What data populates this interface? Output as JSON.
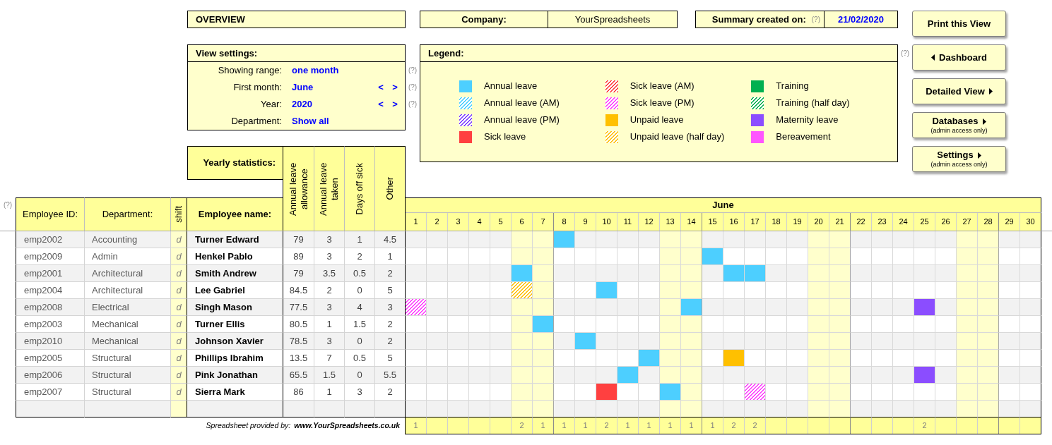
{
  "overview": {
    "title": "OVERVIEW"
  },
  "company": {
    "label": "Company:",
    "value": "YourSpreadsheets"
  },
  "summary": {
    "label": "Summary created on:",
    "help": "(?)",
    "value": "21/02/2020"
  },
  "buttons": [
    {
      "label": "Print this View",
      "kind": "plain"
    },
    {
      "label": "Dashboard",
      "kind": "back"
    },
    {
      "label": "Detailed View",
      "kind": "forward"
    },
    {
      "label": "Databases",
      "kind": "forward",
      "note": "(admin access only)"
    },
    {
      "label": "Settings",
      "kind": "forward",
      "note": "(admin access only)"
    }
  ],
  "view_settings": {
    "title": "View settings:",
    "rows": [
      {
        "label": "Showing range:",
        "value": "one month",
        "help": "(?)"
      },
      {
        "label": "First month:",
        "value": "June",
        "previous": "<",
        "next": ">",
        "help": "(?)"
      },
      {
        "label": "Year:",
        "value": "2020",
        "previous": "<",
        "next": ">",
        "help": "(?)"
      },
      {
        "label": "Department:",
        "value": "Show all"
      }
    ]
  },
  "legend": {
    "title": "Legend:",
    "help": "(?)",
    "columns": [
      {
        "items": [
          {
            "label": "Annual leave",
            "color": "#4dcfff",
            "kind": "solid"
          },
          {
            "label": "Annual leave (AM)",
            "color": "#4dcfff",
            "kind": "hatched"
          },
          {
            "label": "Annual leave (PM)",
            "color": "#7f3fff",
            "kind": "hatched"
          },
          {
            "label": "Sick leave",
            "color": "#ff4040",
            "kind": "solid"
          }
        ]
      },
      {
        "items": [
          {
            "label": "Sick leave (AM)",
            "color": "#ff4040",
            "kind": "hatched"
          },
          {
            "label": "Sick leave (PM)",
            "color": "#ff40ff",
            "kind": "hatched"
          },
          {
            "label": "Unpaid leave",
            "color": "#ffc000",
            "kind": "solid"
          },
          {
            "label": "Unpaid leave (half day)",
            "color": "#ffc000",
            "kind": "hatched"
          }
        ]
      },
      {
        "items": [
          {
            "label": "Training",
            "color": "#00b050",
            "kind": "solid"
          },
          {
            "label": "Training (half day)",
            "color": "#00b050",
            "kind": "hatched"
          },
          {
            "label": "Maternity leave",
            "color": "#8b4dff",
            "kind": "solid"
          },
          {
            "label": "Bereavement",
            "color": "#ff55ff",
            "kind": "solid"
          }
        ]
      }
    ]
  },
  "table": {
    "help": "(?)",
    "statistics_title": "Yearly statistics:",
    "columns": [
      {
        "label": "Employee ID:"
      },
      {
        "label": "Department:"
      },
      {
        "label": "shift"
      },
      {
        "label": "Employee name:"
      }
    ],
    "stat_columns": [
      {
        "label": "Annual leave allowance"
      },
      {
        "label": "Annual leave taken"
      },
      {
        "label": "Days off sick"
      },
      {
        "label": "Other"
      }
    ],
    "month": "June",
    "days": [
      {
        "label": "1",
        "weekend": false,
        "total": "1"
      },
      {
        "label": "2",
        "weekend": false
      },
      {
        "label": "3",
        "weekend": false
      },
      {
        "label": "4",
        "weekend": false
      },
      {
        "label": "5",
        "weekend": false
      },
      {
        "label": "6",
        "weekend": true,
        "total": "2"
      },
      {
        "label": "7",
        "weekend": true,
        "total": "1"
      },
      {
        "label": "8",
        "weekend": false,
        "total": "1"
      },
      {
        "label": "9",
        "weekend": false,
        "total": "1"
      },
      {
        "label": "10",
        "weekend": false,
        "total": "2"
      },
      {
        "label": "11",
        "weekend": false,
        "total": "1"
      },
      {
        "label": "12",
        "weekend": false,
        "total": "1"
      },
      {
        "label": "13",
        "weekend": true,
        "total": "1"
      },
      {
        "label": "14",
        "weekend": true,
        "total": "1"
      },
      {
        "label": "15",
        "weekend": false,
        "total": "1"
      },
      {
        "label": "16",
        "weekend": false,
        "total": "2"
      },
      {
        "label": "17",
        "weekend": false,
        "total": "2"
      },
      {
        "label": "18",
        "weekend": false
      },
      {
        "label": "19",
        "weekend": false
      },
      {
        "label": "20",
        "weekend": true
      },
      {
        "label": "21",
        "weekend": true
      },
      {
        "label": "22",
        "weekend": false
      },
      {
        "label": "23",
        "weekend": false
      },
      {
        "label": "24",
        "weekend": false
      },
      {
        "label": "25",
        "weekend": false,
        "total": "2"
      },
      {
        "label": "26",
        "weekend": false
      },
      {
        "label": "27",
        "weekend": true
      },
      {
        "label": "28",
        "weekend": true
      },
      {
        "label": "29",
        "weekend": false
      },
      {
        "label": "30",
        "weekend": false
      }
    ],
    "rows": [
      {
        "id": "emp2002",
        "department": "Accounting",
        "shift": "d",
        "name": "Turner Edward",
        "stats": [
          "79",
          "3",
          "1",
          "4.5"
        ],
        "cells": [
          {
            "kind": "blank"
          },
          {
            "kind": "blank"
          },
          {
            "kind": "blank"
          },
          {
            "kind": "blank"
          },
          {
            "kind": "blank"
          },
          {
            "kind": "blank"
          },
          {
            "kind": "blank"
          },
          {
            "kind": "solid",
            "color": "#4dcfff"
          },
          {
            "kind": "blank"
          },
          {
            "kind": "blank"
          },
          {
            "kind": "blank"
          },
          {
            "kind": "blank"
          },
          {
            "kind": "blank"
          },
          {
            "kind": "blank"
          },
          {
            "kind": "blank"
          },
          {
            "kind": "blank"
          },
          {
            "kind": "blank"
          },
          {
            "kind": "blank"
          },
          {
            "kind": "blank"
          },
          {
            "kind": "blank"
          },
          {
            "kind": "blank"
          },
          {
            "kind": "blank"
          },
          {
            "kind": "blank"
          },
          {
            "kind": "blank"
          },
          {
            "kind": "blank"
          },
          {
            "kind": "blank"
          },
          {
            "kind": "blank"
          },
          {
            "kind": "blank"
          },
          {
            "kind": "blank"
          },
          {
            "kind": "blank"
          }
        ]
      },
      {
        "id": "emp2009",
        "department": "Admin",
        "shift": "d",
        "name": "Henkel Pablo",
        "stats": [
          "89",
          "3",
          "2",
          "1"
        ],
        "cells": [
          {
            "kind": "blank"
          },
          {
            "kind": "blank"
          },
          {
            "kind": "blank"
          },
          {
            "kind": "blank"
          },
          {
            "kind": "blank"
          },
          {
            "kind": "blank"
          },
          {
            "kind": "blank"
          },
          {
            "kind": "blank"
          },
          {
            "kind": "blank"
          },
          {
            "kind": "blank"
          },
          {
            "kind": "blank"
          },
          {
            "kind": "blank"
          },
          {
            "kind": "blank"
          },
          {
            "kind": "blank"
          },
          {
            "kind": "solid",
            "color": "#4dcfff"
          },
          {
            "kind": "blank"
          },
          {
            "kind": "blank"
          },
          {
            "kind": "blank"
          },
          {
            "kind": "blank"
          },
          {
            "kind": "blank"
          },
          {
            "kind": "blank"
          },
          {
            "kind": "blank"
          },
          {
            "kind": "blank"
          },
          {
            "kind": "blank"
          },
          {
            "kind": "blank"
          },
          {
            "kind": "blank"
          },
          {
            "kind": "blank"
          },
          {
            "kind": "blank"
          },
          {
            "kind": "blank"
          },
          {
            "kind": "blank"
          }
        ]
      },
      {
        "id": "emp2001",
        "department": "Architectural",
        "shift": "d",
        "name": "Smith Andrew",
        "stats": [
          "79",
          "3.5",
          "0.5",
          "2"
        ],
        "cells": [
          {
            "kind": "blank"
          },
          {
            "kind": "blank"
          },
          {
            "kind": "blank"
          },
          {
            "kind": "blank"
          },
          {
            "kind": "blank"
          },
          {
            "kind": "solid",
            "color": "#4dcfff"
          },
          {
            "kind": "blank"
          },
          {
            "kind": "blank"
          },
          {
            "kind": "blank"
          },
          {
            "kind": "blank"
          },
          {
            "kind": "blank"
          },
          {
            "kind": "blank"
          },
          {
            "kind": "blank"
          },
          {
            "kind": "blank"
          },
          {
            "kind": "blank"
          },
          {
            "kind": "solid",
            "color": "#4dcfff"
          },
          {
            "kind": "solid",
            "color": "#4dcfff"
          },
          {
            "kind": "blank"
          },
          {
            "kind": "blank"
          },
          {
            "kind": "blank"
          },
          {
            "kind": "blank"
          },
          {
            "kind": "blank"
          },
          {
            "kind": "blank"
          },
          {
            "kind": "blank"
          },
          {
            "kind": "blank"
          },
          {
            "kind": "blank"
          },
          {
            "kind": "blank"
          },
          {
            "kind": "blank"
          },
          {
            "kind": "blank"
          },
          {
            "kind": "blank"
          }
        ]
      },
      {
        "id": "emp2004",
        "department": "Architectural",
        "shift": "d",
        "name": "Lee Gabriel",
        "stats": [
          "84.5",
          "2",
          "0",
          "5"
        ],
        "cells": [
          {
            "kind": "blank"
          },
          {
            "kind": "blank"
          },
          {
            "kind": "blank"
          },
          {
            "kind": "blank"
          },
          {
            "kind": "blank"
          },
          {
            "kind": "hatched",
            "color": "#ffc000"
          },
          {
            "kind": "blank"
          },
          {
            "kind": "blank"
          },
          {
            "kind": "blank"
          },
          {
            "kind": "solid",
            "color": "#4dcfff"
          },
          {
            "kind": "blank"
          },
          {
            "kind": "blank"
          },
          {
            "kind": "blank"
          },
          {
            "kind": "blank"
          },
          {
            "kind": "blank"
          },
          {
            "kind": "blank"
          },
          {
            "kind": "blank"
          },
          {
            "kind": "blank"
          },
          {
            "kind": "blank"
          },
          {
            "kind": "blank"
          },
          {
            "kind": "blank"
          },
          {
            "kind": "blank"
          },
          {
            "kind": "blank"
          },
          {
            "kind": "blank"
          },
          {
            "kind": "blank"
          },
          {
            "kind": "blank"
          },
          {
            "kind": "blank"
          },
          {
            "kind": "blank"
          },
          {
            "kind": "blank"
          },
          {
            "kind": "blank"
          }
        ]
      },
      {
        "id": "emp2008",
        "department": "Electrical",
        "shift": "d",
        "name": "Singh Mason",
        "stats": [
          "77.5",
          "3",
          "4",
          "3"
        ],
        "cells": [
          {
            "kind": "hatched",
            "color": "#ff40ff"
          },
          {
            "kind": "blank"
          },
          {
            "kind": "blank"
          },
          {
            "kind": "blank"
          },
          {
            "kind": "blank"
          },
          {
            "kind": "blank"
          },
          {
            "kind": "blank"
          },
          {
            "kind": "blank"
          },
          {
            "kind": "blank"
          },
          {
            "kind": "blank"
          },
          {
            "kind": "blank"
          },
          {
            "kind": "blank"
          },
          {
            "kind": "blank"
          },
          {
            "kind": "solid",
            "color": "#4dcfff"
          },
          {
            "kind": "blank"
          },
          {
            "kind": "blank"
          },
          {
            "kind": "blank"
          },
          {
            "kind": "blank"
          },
          {
            "kind": "blank"
          },
          {
            "kind": "blank"
          },
          {
            "kind": "blank"
          },
          {
            "kind": "blank"
          },
          {
            "kind": "blank"
          },
          {
            "kind": "blank"
          },
          {
            "kind": "solid",
            "color": "#8b4dff"
          },
          {
            "kind": "blank"
          },
          {
            "kind": "blank"
          },
          {
            "kind": "blank"
          },
          {
            "kind": "blank"
          },
          {
            "kind": "blank"
          }
        ]
      },
      {
        "id": "emp2003",
        "department": "Mechanical",
        "shift": "d",
        "name": "Turner Ellis",
        "stats": [
          "80.5",
          "1",
          "1.5",
          "2"
        ],
        "cells": [
          {
            "kind": "blank"
          },
          {
            "kind": "blank"
          },
          {
            "kind": "blank"
          },
          {
            "kind": "blank"
          },
          {
            "kind": "blank"
          },
          {
            "kind": "blank"
          },
          {
            "kind": "solid",
            "color": "#4dcfff"
          },
          {
            "kind": "blank"
          },
          {
            "kind": "blank"
          },
          {
            "kind": "blank"
          },
          {
            "kind": "blank"
          },
          {
            "kind": "blank"
          },
          {
            "kind": "blank"
          },
          {
            "kind": "blank"
          },
          {
            "kind": "blank"
          },
          {
            "kind": "blank"
          },
          {
            "kind": "blank"
          },
          {
            "kind": "blank"
          },
          {
            "kind": "blank"
          },
          {
            "kind": "blank"
          },
          {
            "kind": "blank"
          },
          {
            "kind": "blank"
          },
          {
            "kind": "blank"
          },
          {
            "kind": "blank"
          },
          {
            "kind": "blank"
          },
          {
            "kind": "blank"
          },
          {
            "kind": "blank"
          },
          {
            "kind": "blank"
          },
          {
            "kind": "blank"
          },
          {
            "kind": "blank"
          }
        ]
      },
      {
        "id": "emp2010",
        "department": "Mechanical",
        "shift": "d",
        "name": "Johnson Xavier",
        "stats": [
          "78.5",
          "3",
          "0",
          "2"
        ],
        "cells": [
          {
            "kind": "blank"
          },
          {
            "kind": "blank"
          },
          {
            "kind": "blank"
          },
          {
            "kind": "blank"
          },
          {
            "kind": "blank"
          },
          {
            "kind": "blank"
          },
          {
            "kind": "blank"
          },
          {
            "kind": "blank"
          },
          {
            "kind": "solid",
            "color": "#4dcfff"
          },
          {
            "kind": "blank"
          },
          {
            "kind": "blank"
          },
          {
            "kind": "blank"
          },
          {
            "kind": "blank"
          },
          {
            "kind": "blank"
          },
          {
            "kind": "blank"
          },
          {
            "kind": "blank"
          },
          {
            "kind": "blank"
          },
          {
            "kind": "blank"
          },
          {
            "kind": "blank"
          },
          {
            "kind": "blank"
          },
          {
            "kind": "blank"
          },
          {
            "kind": "blank"
          },
          {
            "kind": "blank"
          },
          {
            "kind": "blank"
          },
          {
            "kind": "blank"
          },
          {
            "kind": "blank"
          },
          {
            "kind": "blank"
          },
          {
            "kind": "blank"
          },
          {
            "kind": "blank"
          },
          {
            "kind": "blank"
          }
        ]
      },
      {
        "id": "emp2005",
        "department": "Structural",
        "shift": "d",
        "name": "Phillips Ibrahim",
        "stats": [
          "13.5",
          "7",
          "0.5",
          "5"
        ],
        "cells": [
          {
            "kind": "blank"
          },
          {
            "kind": "blank"
          },
          {
            "kind": "blank"
          },
          {
            "kind": "blank"
          },
          {
            "kind": "blank"
          },
          {
            "kind": "blank"
          },
          {
            "kind": "blank"
          },
          {
            "kind": "blank"
          },
          {
            "kind": "blank"
          },
          {
            "kind": "blank"
          },
          {
            "kind": "blank"
          },
          {
            "kind": "solid",
            "color": "#4dcfff"
          },
          {
            "kind": "blank"
          },
          {
            "kind": "blank"
          },
          {
            "kind": "blank"
          },
          {
            "kind": "solid",
            "color": "#ffc000"
          },
          {
            "kind": "blank"
          },
          {
            "kind": "blank"
          },
          {
            "kind": "blank"
          },
          {
            "kind": "blank"
          },
          {
            "kind": "blank"
          },
          {
            "kind": "blank"
          },
          {
            "kind": "blank"
          },
          {
            "kind": "blank"
          },
          {
            "kind": "blank"
          },
          {
            "kind": "blank"
          },
          {
            "kind": "blank"
          },
          {
            "kind": "blank"
          },
          {
            "kind": "blank"
          },
          {
            "kind": "blank"
          }
        ]
      },
      {
        "id": "emp2006",
        "department": "Structural",
        "shift": "d",
        "name": "Pink Jonathan",
        "stats": [
          "65.5",
          "1.5",
          "0",
          "5.5"
        ],
        "cells": [
          {
            "kind": "blank"
          },
          {
            "kind": "blank"
          },
          {
            "kind": "blank"
          },
          {
            "kind": "blank"
          },
          {
            "kind": "blank"
          },
          {
            "kind": "blank"
          },
          {
            "kind": "blank"
          },
          {
            "kind": "blank"
          },
          {
            "kind": "blank"
          },
          {
            "kind": "blank"
          },
          {
            "kind": "solid",
            "color": "#4dcfff"
          },
          {
            "kind": "blank"
          },
          {
            "kind": "blank"
          },
          {
            "kind": "blank"
          },
          {
            "kind": "blank"
          },
          {
            "kind": "blank"
          },
          {
            "kind": "blank"
          },
          {
            "kind": "blank"
          },
          {
            "kind": "blank"
          },
          {
            "kind": "blank"
          },
          {
            "kind": "blank"
          },
          {
            "kind": "blank"
          },
          {
            "kind": "blank"
          },
          {
            "kind": "blank"
          },
          {
            "kind": "solid",
            "color": "#8b4dff"
          },
          {
            "kind": "blank"
          },
          {
            "kind": "blank"
          },
          {
            "kind": "blank"
          },
          {
            "kind": "blank"
          },
          {
            "kind": "blank"
          }
        ]
      },
      {
        "id": "emp2007",
        "department": "Structural",
        "shift": "d",
        "name": "Sierra Mark",
        "stats": [
          "86",
          "1",
          "3",
          "2"
        ],
        "cells": [
          {
            "kind": "blank"
          },
          {
            "kind": "blank"
          },
          {
            "kind": "blank"
          },
          {
            "kind": "blank"
          },
          {
            "kind": "blank"
          },
          {
            "kind": "blank"
          },
          {
            "kind": "blank"
          },
          {
            "kind": "blank"
          },
          {
            "kind": "blank"
          },
          {
            "kind": "solid",
            "color": "#ff4040"
          },
          {
            "kind": "blank"
          },
          {
            "kind": "blank"
          },
          {
            "kind": "solid",
            "color": "#4dcfff"
          },
          {
            "kind": "blank"
          },
          {
            "kind": "blank"
          },
          {
            "kind": "blank"
          },
          {
            "kind": "hatched",
            "color": "#ff40ff"
          },
          {
            "kind": "blank"
          },
          {
            "kind": "blank"
          },
          {
            "kind": "blank"
          },
          {
            "kind": "blank"
          },
          {
            "kind": "blank"
          },
          {
            "kind": "blank"
          },
          {
            "kind": "blank"
          },
          {
            "kind": "blank"
          },
          {
            "kind": "blank"
          },
          {
            "kind": "blank"
          },
          {
            "kind": "blank"
          },
          {
            "kind": "blank"
          },
          {
            "kind": "blank"
          }
        ]
      }
    ]
  },
  "credit": {
    "label": "Spreadsheet provided by:",
    "link": "www.YourSpreadsheets.co.uk"
  }
}
